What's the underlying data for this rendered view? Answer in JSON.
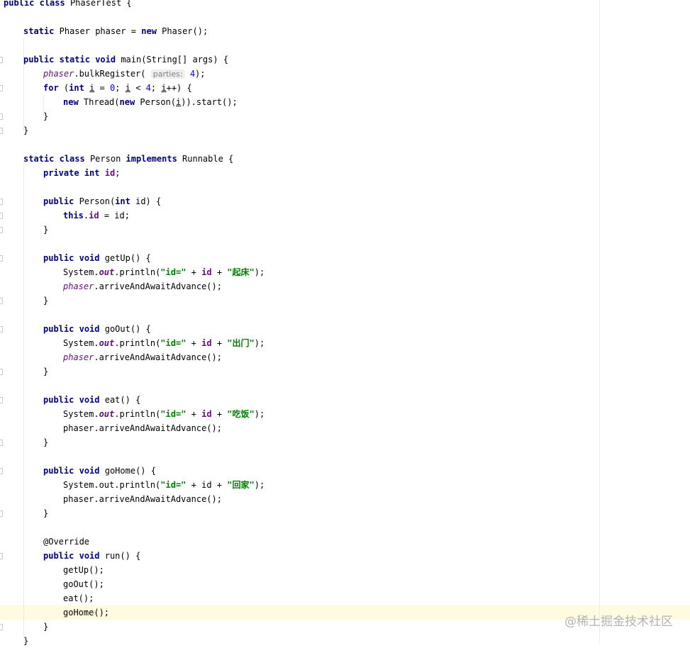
{
  "code": {
    "class_decl": {
      "public": "public",
      "class": "class",
      "name": "PhaserTest {"
    },
    "phaser_decl": {
      "static": "static",
      "type": "Phaser",
      "name": "phaser",
      "eq": "=",
      "new": "new",
      "ctor": "Phaser();"
    },
    "main_decl": {
      "public": "public",
      "static": "static",
      "void": "void",
      "sig": "main(String[] args) {"
    },
    "bulk_register": {
      "obj": "phaser",
      "call": ".bulkRegister(",
      "hint": "parties:",
      "arg": "4",
      "end": ");"
    },
    "for_loop": {
      "for": "for",
      "open": "(",
      "int": "int",
      "i1": "i",
      "a": "=",
      "zero": "0",
      "semi1": ";",
      "i2": "i",
      "lt": "<",
      "four": "4",
      "semi2": ";",
      "i3": "i",
      "inc": "++) {"
    },
    "thread_start": {
      "new1": "new",
      "thread": "Thread(",
      "new2": "new",
      "person": "Person(",
      "i": "i",
      "end": ")).start();"
    },
    "close_brace": "}",
    "person_class": {
      "static": "static",
      "class": "class",
      "name": "Person",
      "implements": "implements",
      "iface": "Runnable {"
    },
    "field_id": {
      "private": "private",
      "int": "int",
      "name": "id",
      "semi": ";"
    },
    "person_ctor": {
      "public": "public",
      "sig_a": "Person(",
      "int": "int",
      "sig_b": "id) {"
    },
    "this_assign": {
      "this": "this",
      "dot": ".",
      "field": "id",
      "rest": "= id;"
    },
    "get_up": {
      "public": "public",
      "void": "void",
      "sig": "getUp() {"
    },
    "go_out": {
      "public": "public",
      "void": "void",
      "sig": "goOut() {"
    },
    "eat": {
      "public": "public",
      "void": "void",
      "sig": "eat() {"
    },
    "go_home": {
      "public": "public",
      "void": "void",
      "sig": "goHome() {"
    },
    "println_prefix": "System.",
    "out_field": "out",
    "println_call": ".println(",
    "id_eq_str": "\"id=\"",
    "plus": "+",
    "id_field": "id",
    "println_end": ");",
    "plain_println": "System.out.println(",
    "plain_id": "id",
    "str_getup": "\"起床\"",
    "str_goout": "\"出门\"",
    "str_eat": "\"吃饭\"",
    "str_gohome": "\"回家\"",
    "phaser_field": "phaser",
    "arrive_call": ".arriveAndAwaitAdvance();",
    "plain_arrive": "phaser.arriveAndAwaitAdvance();",
    "override": "@Override",
    "run": {
      "public": "public",
      "void": "void",
      "sig": "run() {"
    },
    "call_getup": "getUp();",
    "call_goout": "goOut();",
    "call_eat": "eat();",
    "call_gohome": "goHome();"
  },
  "watermark": "@稀土掘金技术社区"
}
